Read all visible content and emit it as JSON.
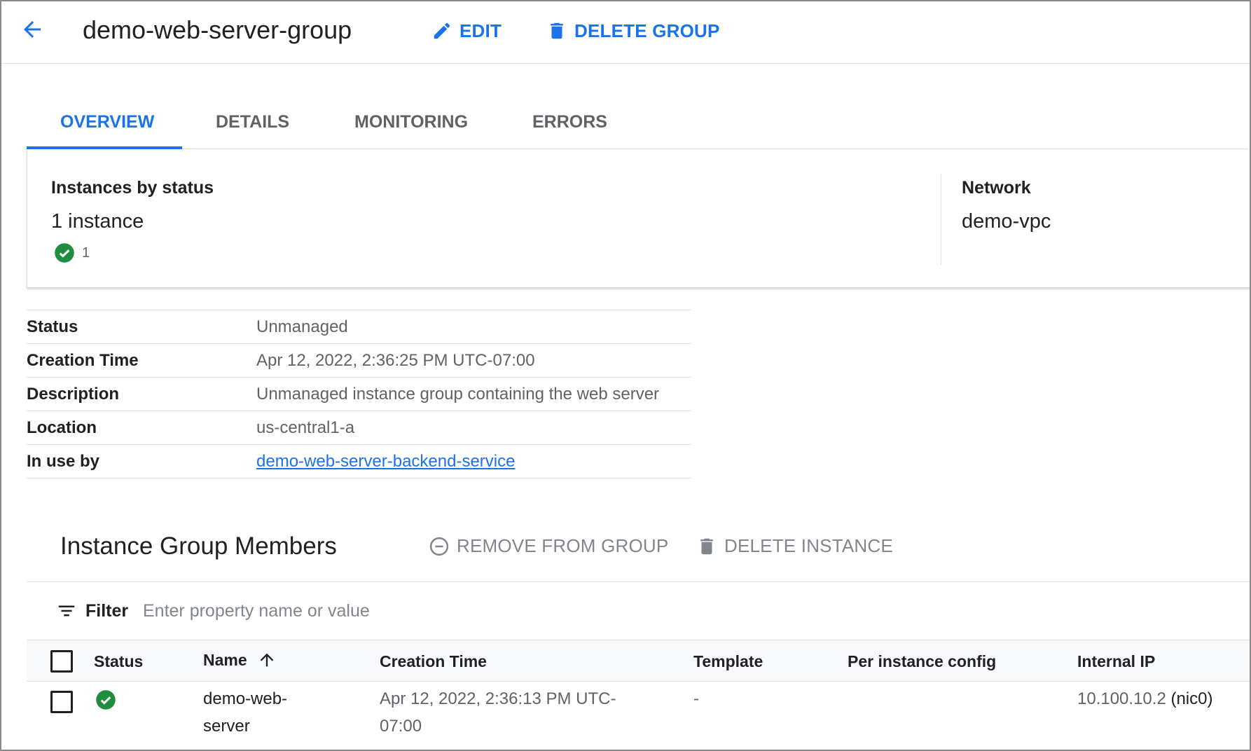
{
  "header": {
    "title": "demo-web-server-group",
    "edit_label": "EDIT",
    "delete_label": "DELETE GROUP"
  },
  "tabs": [
    {
      "label": "OVERVIEW",
      "active": true
    },
    {
      "label": "DETAILS",
      "active": false
    },
    {
      "label": "MONITORING",
      "active": false
    },
    {
      "label": "ERRORS",
      "active": false
    }
  ],
  "overview": {
    "instances_label": "Instances by status",
    "instances_count": "1 instance",
    "running_count": "1",
    "network_label": "Network",
    "network_value": "demo-vpc"
  },
  "properties": [
    {
      "key": "Status",
      "value": "Unmanaged"
    },
    {
      "key": "Creation Time",
      "value": "Apr 12, 2022, 2:36:25 PM UTC-07:00"
    },
    {
      "key": "Description",
      "value": "Unmanaged instance group containing the web server"
    },
    {
      "key": "Location",
      "value": "us-central1-a"
    },
    {
      "key": "In use by",
      "value": "demo-web-server-backend-service",
      "link": true
    }
  ],
  "members": {
    "title": "Instance Group Members",
    "remove_label": "REMOVE FROM GROUP",
    "delete_label": "DELETE INSTANCE",
    "filter_label": "Filter",
    "filter_placeholder": "Enter property name or value",
    "columns": {
      "status": "Status",
      "name": "Name",
      "creation_time": "Creation Time",
      "template": "Template",
      "per_instance_config": "Per instance config",
      "internal_ip": "Internal IP"
    },
    "rows": [
      {
        "name_line1": "demo-web-",
        "name_line2": "server",
        "creation_line1": "Apr 12, 2022, 2:36:13 PM UTC-",
        "creation_line2": "07:00",
        "template": "-",
        "per_instance_config": "",
        "internal_ip": "10.100.10.2",
        "nic": "(nic0)"
      }
    ]
  },
  "colors": {
    "accent": "#1a73e8",
    "success": "#1e8e3e",
    "text": "#202124",
    "muted": "#5f6368"
  }
}
